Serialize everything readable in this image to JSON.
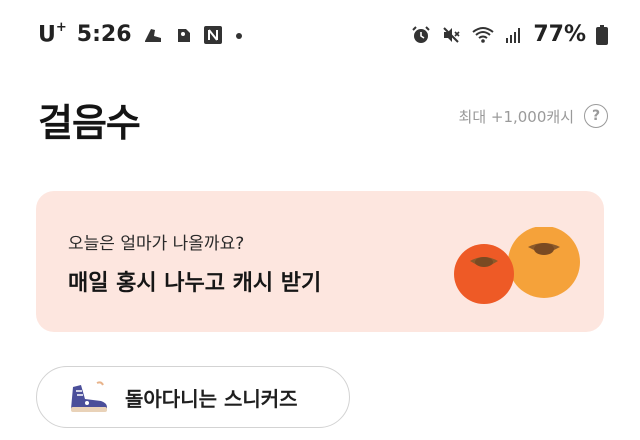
{
  "status_bar": {
    "carrier": "U",
    "carrier_sup": "+",
    "time": "5:26",
    "battery": "77%",
    "icons": [
      "sneaker-notification-icon",
      "app-notification-icon",
      "naver-icon",
      "dot-icon",
      "alarm-icon",
      "mute-icon",
      "wifi-icon",
      "signal-icon",
      "battery-icon"
    ]
  },
  "header": {
    "title": "걸음수",
    "max_reward": "최대 +1,000캐시",
    "help_icon": "?"
  },
  "banner": {
    "subtitle": "오늘은 얼마가 나올까요?",
    "title": "매일 홍시 나누고 캐시 받기",
    "illustration": "persimmons-icon",
    "background": "#fde6df"
  },
  "chip": {
    "label": "돌아다니는 스니커즈",
    "icon": "sneaker-icon"
  }
}
